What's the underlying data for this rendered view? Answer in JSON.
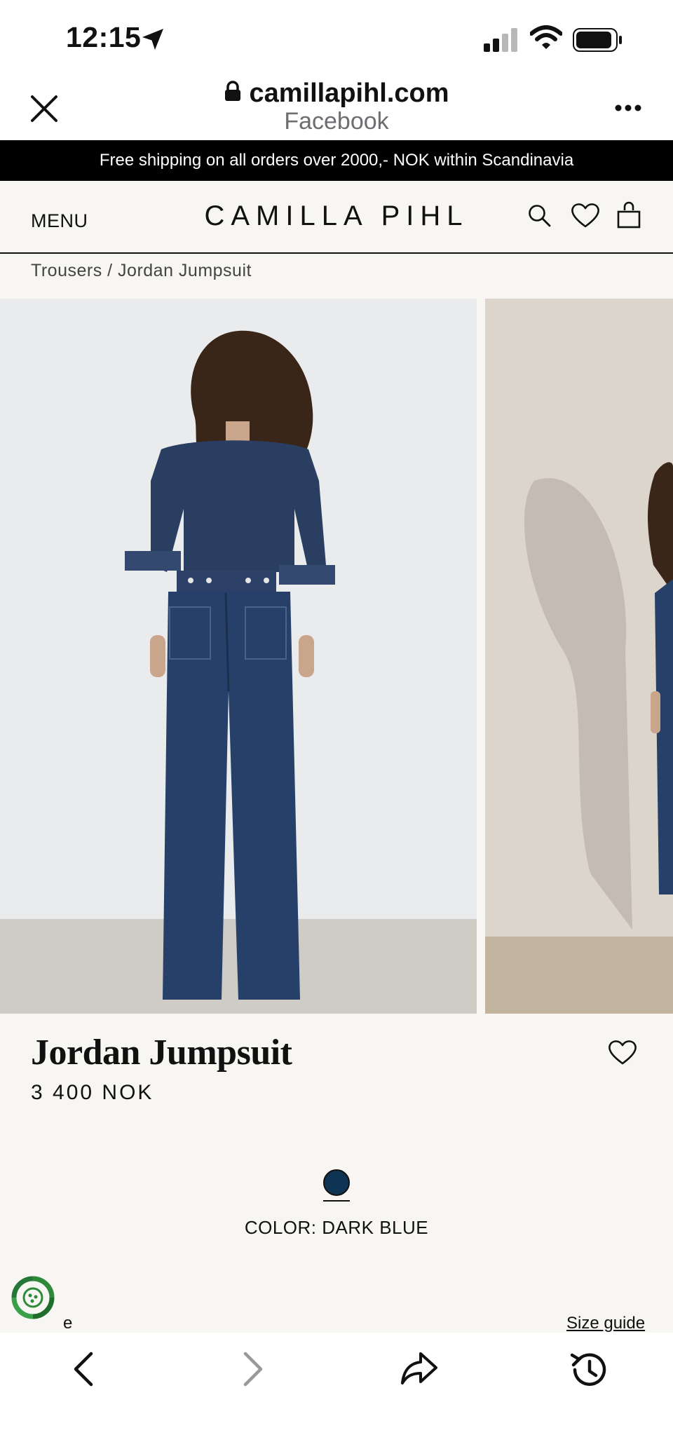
{
  "status_bar": {
    "time": "12:15"
  },
  "browser": {
    "domain": "camillapihl.com",
    "source": "Facebook"
  },
  "announcement": "Free shipping on all orders over 2000,- NOK within Scandinavia",
  "header": {
    "menu_label": "MENU",
    "logo": "CAMILLA PIHL"
  },
  "breadcrumb": "Trousers / Jordan Jumpsuit",
  "product": {
    "title": "Jordan Jumpsuit",
    "price": "3 400 NOK",
    "color_label": "COLOR: DARK BLUE",
    "swatch_color": "#0f3352",
    "size_prefix": "e",
    "size_guide": "Size guide"
  },
  "icons": [
    "location-arrow-icon",
    "signal-icon",
    "wifi-icon",
    "battery-icon",
    "close-icon",
    "lock-icon",
    "more-icon",
    "search-icon",
    "heart-icon",
    "bag-icon",
    "eco-icon",
    "back-icon",
    "forward-icon",
    "share-icon",
    "history-icon"
  ]
}
